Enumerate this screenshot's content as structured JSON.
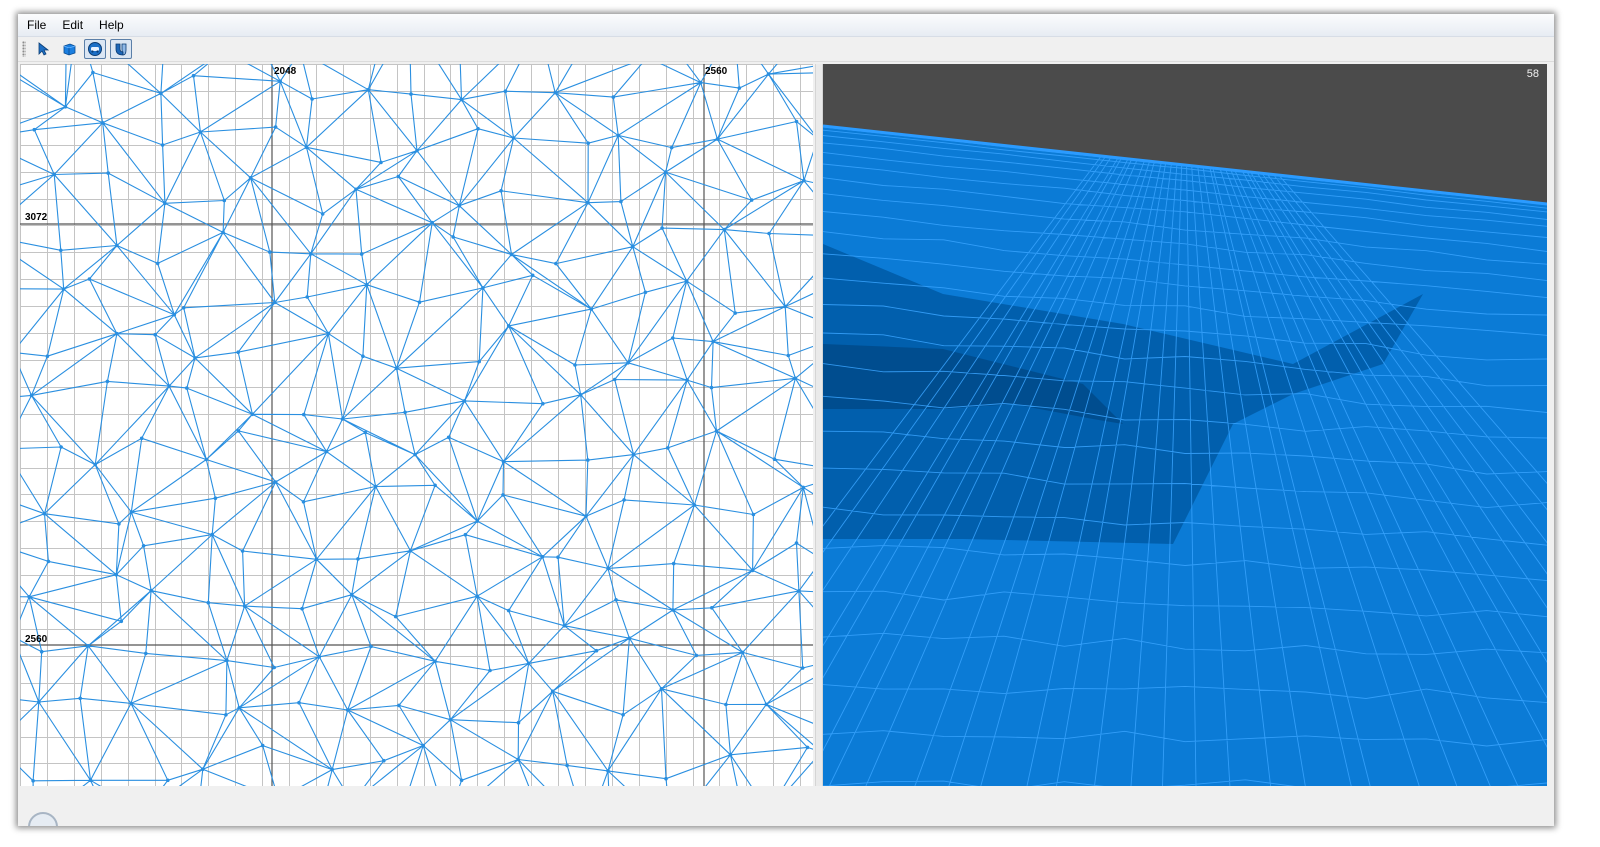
{
  "menu": {
    "file": "File",
    "edit": "Edit",
    "help": "Help"
  },
  "toolbar": {
    "tools": [
      {
        "icon": "pointer-arrow-icon",
        "pressed": false
      },
      {
        "icon": "cube-icon",
        "pressed": false
      },
      {
        "icon": "car-view-icon",
        "pressed": true
      },
      {
        "icon": "magnet-icon",
        "pressed": true
      }
    ]
  },
  "grid_view": {
    "labels": {
      "x_2048": "2048",
      "x_2560": "2560",
      "y_3072": "3072",
      "y_2560": "2560"
    },
    "mesh_color": "#2a8fe0",
    "grid_color": "#c4c4c4",
    "major_grid_color": "#555555"
  },
  "view3d": {
    "fps": "58",
    "background_color": "#4b4b4b",
    "surface_color": "#0b7bd6"
  }
}
